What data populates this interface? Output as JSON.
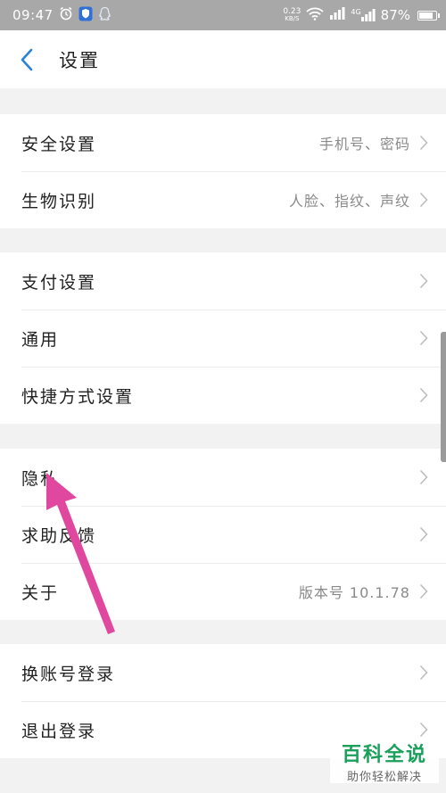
{
  "status_bar": {
    "time": "09:47",
    "net_speed_value": "0.23",
    "net_speed_unit": "KB/S",
    "network_type": "4G",
    "battery_percent": "87%",
    "battery_level": 0.87,
    "icons": [
      "alarm-icon",
      "shield-app-icon",
      "qq-icon",
      "wifi-icon",
      "signal-icon",
      "signal-4g-icon",
      "battery-icon"
    ]
  },
  "header": {
    "title": "设置"
  },
  "groups": [
    {
      "items": [
        {
          "label": "安全设置",
          "value": "手机号、密码"
        },
        {
          "label": "生物识别",
          "value": "人脸、指纹、声纹"
        }
      ]
    },
    {
      "items": [
        {
          "label": "支付设置",
          "value": ""
        },
        {
          "label": "通用",
          "value": ""
        },
        {
          "label": "快捷方式设置",
          "value": ""
        }
      ]
    },
    {
      "items": [
        {
          "label": "隐私",
          "value": ""
        },
        {
          "label": "求助反馈",
          "value": ""
        },
        {
          "label": "关于",
          "value": "版本号 10.1.78"
        }
      ]
    },
    {
      "items": [
        {
          "label": "换账号登录",
          "value": ""
        },
        {
          "label": "退出登录",
          "value": ""
        }
      ]
    }
  ],
  "watermark": {
    "title": "百科全说",
    "subtitle": "助你轻松解决"
  },
  "colors": {
    "status_bar": "#a8a8a8",
    "accent_back": "#2a82d8",
    "annotation_arrow": "#e0479e",
    "watermark_green": "#1aa05a"
  }
}
